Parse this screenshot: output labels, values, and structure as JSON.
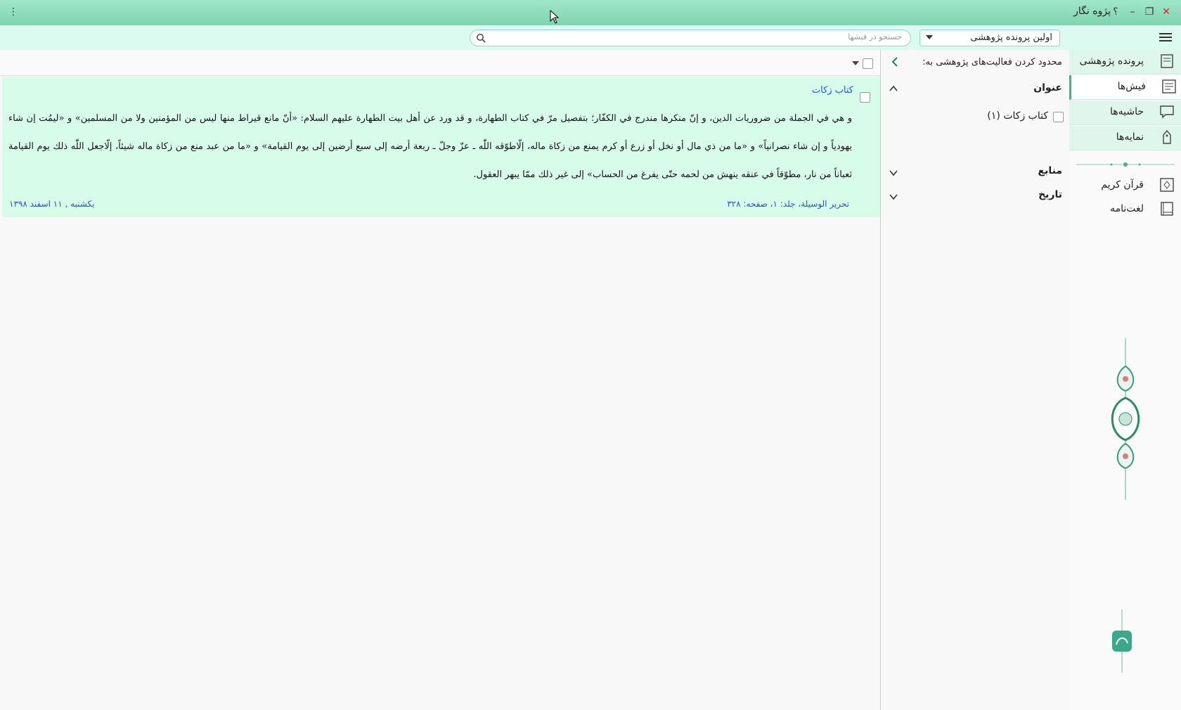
{
  "window": {
    "title": "پژوه نگار",
    "menu_glyph": "⋮",
    "help_glyph": "؟",
    "minimize_glyph": "–",
    "restore_glyph": "❐",
    "close_glyph": "✕"
  },
  "toolbar": {
    "search_placeholder": "جستجو در فیشها",
    "research_file": "اولین پرونده پژوهشی"
  },
  "nav": {
    "items": [
      {
        "label": "پرونده پژوهشی",
        "icon": "folder-icon"
      },
      {
        "label": "فیش‌ها",
        "icon": "note-card-icon",
        "active": true
      },
      {
        "label": "حاشیه‌ها",
        "icon": "comment-icon"
      },
      {
        "label": "نمایه‌ها",
        "icon": "tag-icon"
      }
    ],
    "extras": [
      {
        "label": "قرآن کریم",
        "icon": "quran-icon"
      },
      {
        "label": "لغت‌نامه",
        "icon": "dictionary-icon"
      }
    ]
  },
  "filter": {
    "header": "محدود کردن فعالیت‌های پژوهشی به:",
    "sections": [
      {
        "label": "عنوان",
        "expanded": true,
        "options": [
          {
            "label": "کتاب زکات (۱)",
            "checked": false
          }
        ]
      },
      {
        "label": "منابع",
        "expanded": false
      },
      {
        "label": "تاریخ",
        "expanded": false
      }
    ]
  },
  "cards": [
    {
      "title": "کتاب زکات",
      "text": "و هي في الجملة من ضروريات الدين، و إنّ منكرها مندرج في الكفّار؛ بتفصيل مرّ في كتاب الطهارة، و قد ورد عن أهل بيت الطهارة عليهم السلام: «أنّ مانع قيراط منها ليس من المؤمنين ولا من المسلمين» و «ليمُت إن شاء يهودياً و إن شاء نصرانياً» و «ما من ذي مال أو نخل أو زرع أو كرم يمنع من زكاة ماله، إلّاطوّقه اللّٰه ـ عزّ وجلّ ـ ربعة أرضه إلى سبع أرضين إلى يوم القيامة» و «ما من عبد منع من زكاة ماله شيئاً، إلّاجعل اللّٰه ذلك يوم القيامة ثعباناً من نار، مطوّقاً في عنقه ينهش من لحمه حتّى يفرغ من الحساب» إلى غير ذلك ممّا يبهر العقول.",
      "source": "تحرير الوسيلة، جلد: ۱، صفحه: ۳۲۸",
      "date": "یکشنبه , ۱۱ اسفند ۱۳۹۸"
    }
  ],
  "colors": {
    "titlebar": "#8fdcbc",
    "toolbar": "#dcfbf0",
    "card_bg": "#d7fce9",
    "accent": "#39b38a",
    "link": "#1e5ad8"
  }
}
